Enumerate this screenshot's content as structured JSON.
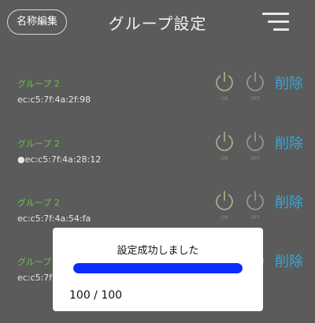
{
  "header": {
    "rename_label": "名称編集",
    "title": "グループ設定",
    "menu_icon": "hamburger-menu-icon"
  },
  "groups": [
    {
      "name": "グループ 2",
      "mac": "ec:c5:7f:4a:2f:98",
      "on_label": "ON",
      "off_label": "OFF",
      "delete_label": "削除"
    },
    {
      "name": "グループ 2",
      "mac": "●ec:c5:7f:4a:28:12",
      "on_label": "ON",
      "off_label": "OFF",
      "delete_label": "削除"
    },
    {
      "name": "グループ 2",
      "mac": "ec:c5:7f:4a:54:fa",
      "on_label": "ON",
      "off_label": "OFF",
      "delete_label": "削除"
    },
    {
      "name": "グループ 2",
      "mac": "ec:c5:7f:",
      "on_label": "",
      "off_label": "",
      "delete_label": "削除"
    }
  ],
  "dialog": {
    "message": "設定成功しました",
    "progress_fraction": 1.0,
    "progress_text": "100 / 100"
  },
  "colors": {
    "background": "#5b5b5b",
    "group_name": "#6cc24a",
    "delete": "#3aa6d6",
    "power_on": "#b5b28a",
    "power_off": "#9a9a9a",
    "progress": "#0a2cff"
  }
}
